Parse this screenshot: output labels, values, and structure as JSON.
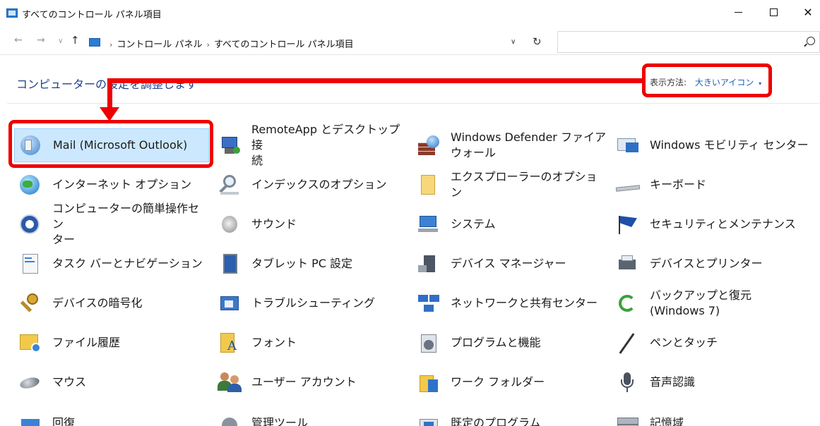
{
  "window": {
    "title": "すべてのコントロール パネル項目",
    "controls": {
      "minimize": "—",
      "maximize": "",
      "close": "✕"
    }
  },
  "address": {
    "back": "←",
    "forward": "→",
    "recent": "∨",
    "up": "↑",
    "crumbs": [
      "コントロール パネル",
      "すべてのコントロール パネル項目"
    ],
    "separator": "›",
    "dropdown": "∨",
    "refresh": "↻",
    "search_placeholder": ""
  },
  "heading": "コンピューターの設定を調整します",
  "view_by": {
    "label": "表示方法:",
    "value": "大きいアイコン",
    "caret": "▾"
  },
  "items": [
    {
      "label": "Mail (Microsoft Outlook)",
      "icon": "mail-icon",
      "selected": true
    },
    {
      "label": "RemoteApp とデスクトップ接\n続",
      "icon": "remoteapp-icon"
    },
    {
      "label": "Windows Defender ファイア\nウォール",
      "icon": "firewall-icon"
    },
    {
      "label": "Windows モビリティ センター",
      "icon": "mobility-icon"
    },
    {
      "label": "インターネット オプション",
      "icon": "internet-options-icon"
    },
    {
      "label": "インデックスのオプション",
      "icon": "indexing-icon"
    },
    {
      "label": "エクスプローラーのオプション",
      "icon": "folder-options-icon"
    },
    {
      "label": "キーボード",
      "icon": "keyboard-icon"
    },
    {
      "label": "コンピューターの簡単操作セン\nター",
      "icon": "ease-of-access-icon"
    },
    {
      "label": "サウンド",
      "icon": "sound-icon"
    },
    {
      "label": "システム",
      "icon": "system-icon"
    },
    {
      "label": "セキュリティとメンテナンス",
      "icon": "security-flag-icon"
    },
    {
      "label": "タスク バーとナビゲーション",
      "icon": "taskbar-icon"
    },
    {
      "label": "タブレット PC 設定",
      "icon": "tablet-icon"
    },
    {
      "label": "デバイス マネージャー",
      "icon": "device-manager-icon"
    },
    {
      "label": "デバイスとプリンター",
      "icon": "printer-icon"
    },
    {
      "label": "デバイスの暗号化",
      "icon": "encryption-key-icon"
    },
    {
      "label": "トラブルシューティング",
      "icon": "troubleshooting-icon"
    },
    {
      "label": "ネットワークと共有センター",
      "icon": "network-icon"
    },
    {
      "label": "バックアップと復元\n(Windows 7)",
      "icon": "backup-icon"
    },
    {
      "label": "ファイル履歴",
      "icon": "file-history-icon"
    },
    {
      "label": "フォント",
      "icon": "fonts-icon"
    },
    {
      "label": "プログラムと機能",
      "icon": "programs-icon"
    },
    {
      "label": "ペンとタッチ",
      "icon": "pen-icon"
    },
    {
      "label": "マウス",
      "icon": "mouse-icon"
    },
    {
      "label": "ユーザー アカウント",
      "icon": "user-accounts-icon"
    },
    {
      "label": "ワーク フォルダー",
      "icon": "work-folders-icon"
    },
    {
      "label": "音声認識",
      "icon": "microphone-icon"
    },
    {
      "label": "回復",
      "icon": "recovery-icon"
    },
    {
      "label": "管理ツール",
      "icon": "admin-tools-icon"
    },
    {
      "label": "既定のプログラム",
      "icon": "default-programs-icon"
    },
    {
      "label": "記憶域",
      "icon": "storage-icon"
    }
  ],
  "annotation_color": "#ee0000"
}
